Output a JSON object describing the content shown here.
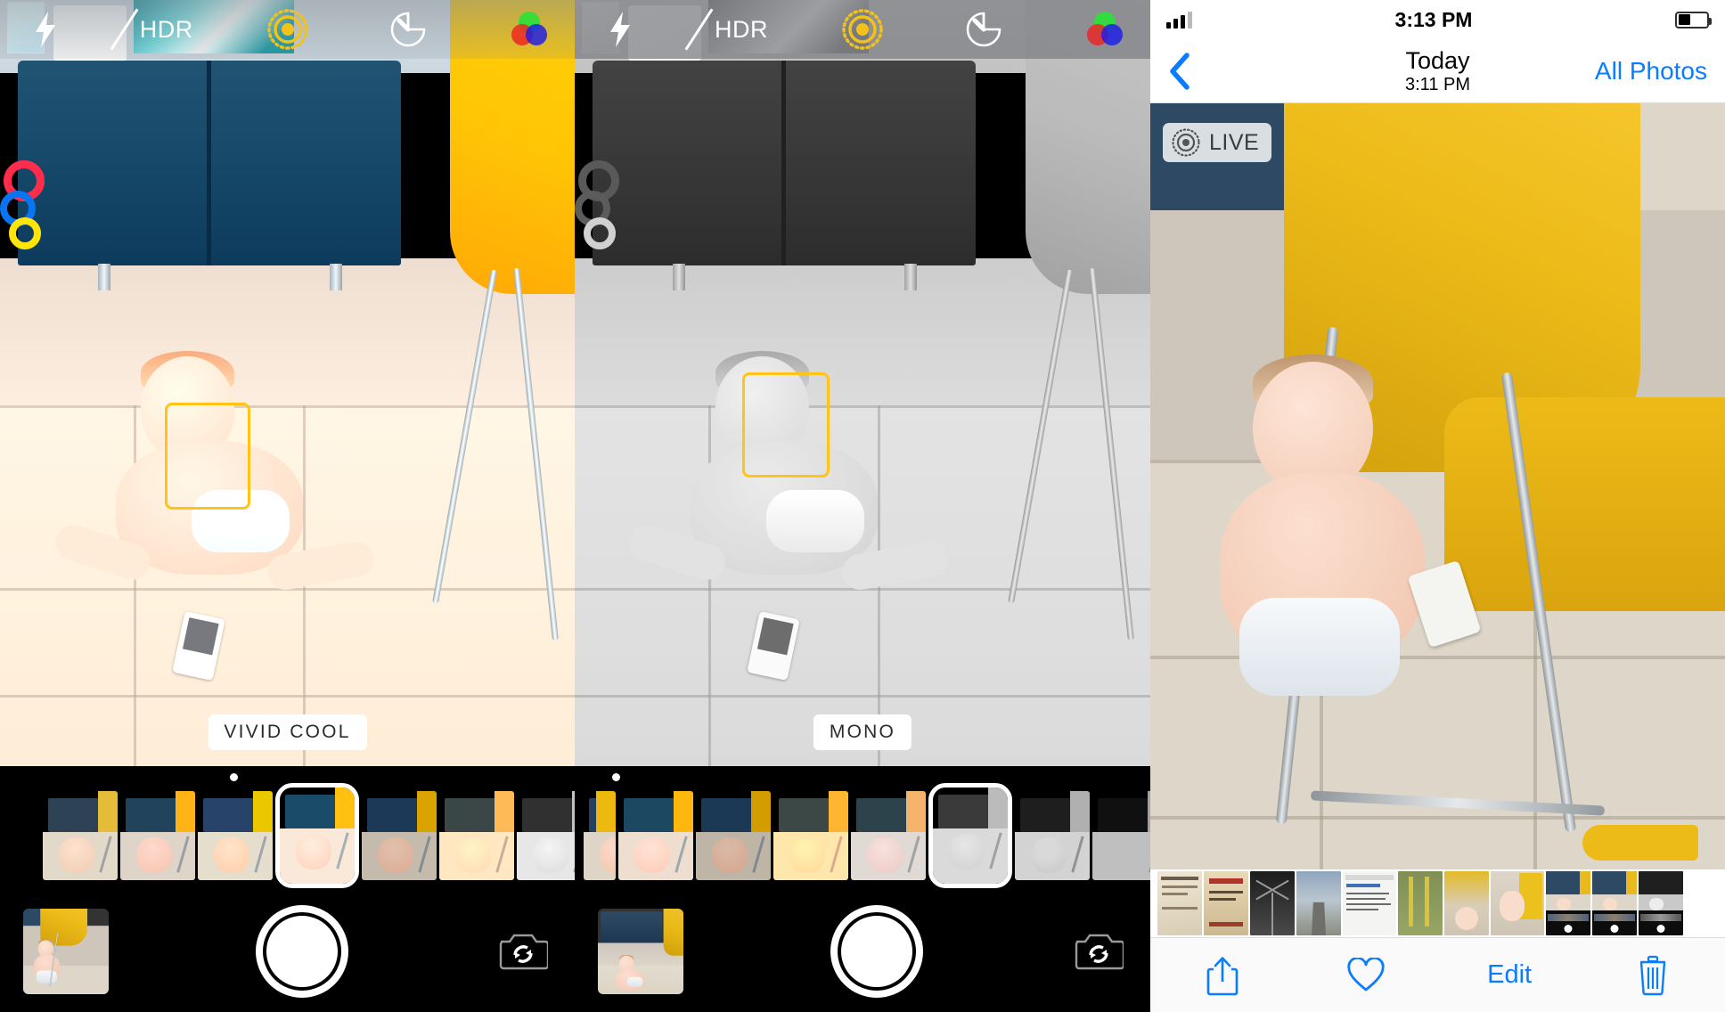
{
  "camera_left": {
    "topbar": {
      "flash_icon": "flash-bolt-icon",
      "hdr_label": "HDR",
      "hdr_state": "off",
      "live_photo_icon": "live-photo-icon",
      "timer_icon": "timer-icon",
      "filters_icon": "color-filters-icon"
    },
    "filter_name": "VIVID COOL",
    "selected_filter_index": 3,
    "face_detection": "face-detection-box",
    "controls": {
      "thumbnail": "last-photo-thumbnail",
      "shutter": "shutter-button",
      "flip": "flip-camera-icon"
    }
  },
  "camera_right": {
    "topbar": {
      "flash_icon": "flash-bolt-icon",
      "hdr_label": "HDR",
      "hdr_state": "off",
      "live_photo_icon": "live-photo-icon",
      "timer_icon": "timer-icon",
      "filters_icon": "color-filters-icon"
    },
    "filter_name": "MONO",
    "selected_filter_index": 4,
    "face_detection": "face-detection-box",
    "controls": {
      "thumbnail": "last-photo-thumbnail",
      "shutter": "shutter-button",
      "flip": "flip-camera-icon"
    }
  },
  "viewer": {
    "status_bar": {
      "time": "3:13 PM",
      "signal_bars_filled": 3,
      "signal_bars_total": 4,
      "battery_icon": "battery-icon"
    },
    "nav": {
      "back_icon": "back-chevron-icon",
      "title": "Today",
      "subtitle": "3:11 PM",
      "right_action": "All Photos"
    },
    "live_badge": {
      "icon": "live-photo-icon",
      "label": "LIVE"
    },
    "toolbar": {
      "share_icon": "share-icon",
      "favorite_icon": "heart-icon",
      "edit_label": "Edit",
      "delete_icon": "trash-icon"
    },
    "filmstrip_count": 11
  },
  "colors": {
    "ios_blue": "#0a7cff",
    "face_box_yellow": "#ffc417",
    "live_yellow": "#f2c21a",
    "chip_bg": "#ffffff",
    "chip_text": "#2b2b2b"
  }
}
